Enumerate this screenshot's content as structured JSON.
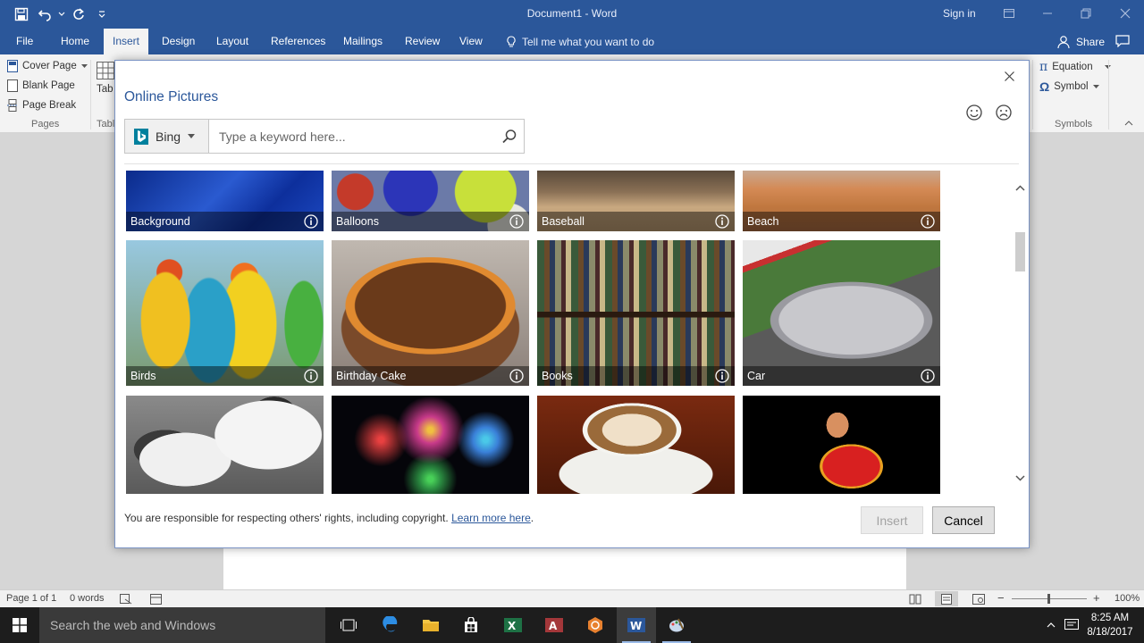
{
  "window": {
    "title": "Document1  -  Word",
    "signin_label": "Sign in"
  },
  "ribbon_tabs": [
    {
      "label": "File"
    },
    {
      "label": "Home"
    },
    {
      "label": "Insert"
    },
    {
      "label": "Design"
    },
    {
      "label": "Layout"
    },
    {
      "label": "References"
    },
    {
      "label": "Mailings"
    },
    {
      "label": "Review"
    },
    {
      "label": "View"
    }
  ],
  "active_tab": "Insert",
  "tell_me": "Tell me what you want to do",
  "share_label": "Share",
  "ribbon": {
    "pages": {
      "cover_page": "Cover Page",
      "blank_page": "Blank Page",
      "page_break": "Page Break",
      "group_label": "Pages"
    },
    "table_partial": "Tab",
    "table_group_partial": "Tabl",
    "symbols": {
      "equation": "Equation",
      "symbol": "Symbol",
      "group_label": "Symbols"
    }
  },
  "dialog": {
    "title": "Online Pictures",
    "source": "Bing",
    "search_placeholder": "Type a keyword here...",
    "tiles": [
      {
        "label": "Background"
      },
      {
        "label": "Balloons"
      },
      {
        "label": "Baseball"
      },
      {
        "label": "Beach"
      },
      {
        "label": "Birds"
      },
      {
        "label": "Birthday Cake"
      },
      {
        "label": "Books"
      },
      {
        "label": "Car"
      },
      {
        "label": ""
      },
      {
        "label": ""
      },
      {
        "label": ""
      },
      {
        "label": ""
      }
    ],
    "footer_text": "You are responsible for respecting others' rights, including copyright.",
    "learn_more": "Learn more here",
    "footer_period": ".",
    "insert_label": "Insert",
    "cancel_label": "Cancel"
  },
  "statusbar": {
    "page": "Page 1 of 1",
    "words": "0 words",
    "zoom": "100%"
  },
  "taskbar": {
    "search_placeholder": "Search the web and Windows",
    "time": "8:25 AM",
    "date": "8/18/2017"
  },
  "colors": {
    "word_blue": "#2b579a",
    "ribbon_bg": "#f3f3f3"
  }
}
